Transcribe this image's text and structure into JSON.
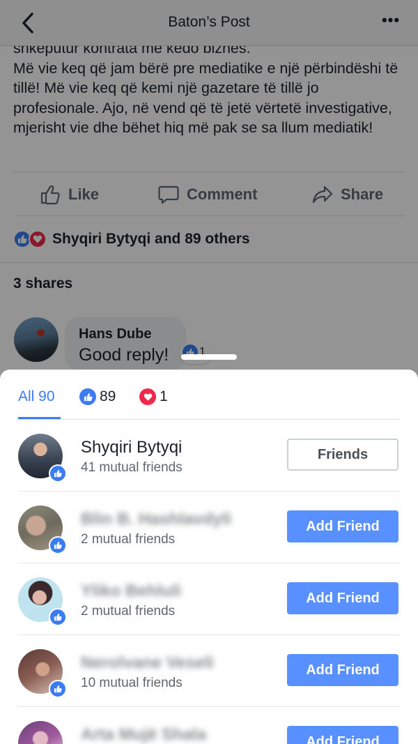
{
  "header": {
    "title": "Baton’s Post"
  },
  "post": {
    "text_lines": [
      "shkeputur kontrata me kedo biznes.",
      "Më vie keq që jam bërë pre mediatike e një përbindëshi të tillë! Më vie keq që kemi një gazetare të tillë jo profesionale. Ajo, në vend që të jetë vërtetë investigative, mjerisht vie dhe bëhet hiq më pak se sa llum mediatik!"
    ],
    "actions": {
      "like": "Like",
      "comment": "Comment",
      "share": "Share"
    },
    "reactions_summary": "Shyqiri Bytyqi and 89 others",
    "shares": "3 shares",
    "comment": {
      "author": "Hans Dube",
      "text": "Good reply!",
      "likes": "1"
    }
  },
  "sheet": {
    "tabs": {
      "all": "All 90",
      "like_count": "89",
      "love_count": "1"
    },
    "people": [
      {
        "name": "Shyqiri Bytyqi",
        "mutual": "41 mutual friends",
        "button": "Friends",
        "blurred": false
      },
      {
        "name": "Blin B. Hashlavdyli",
        "mutual": "2 mutual friends",
        "button": "Add Friend",
        "blurred": true
      },
      {
        "name": "Yliko Behluli",
        "mutual": "2 mutual friends",
        "button": "Add Friend",
        "blurred": true
      },
      {
        "name": "Nerolvane Veseli",
        "mutual": "10 mutual friends",
        "button": "Add Friend",
        "blurred": true
      },
      {
        "name": "Arta Mujë Shala",
        "mutual": "",
        "button": "Add Friend",
        "blurred": true
      }
    ]
  },
  "colors": {
    "accent": "#3b7cf2",
    "love": "#f0284a",
    "add_button": "#5890ff"
  }
}
